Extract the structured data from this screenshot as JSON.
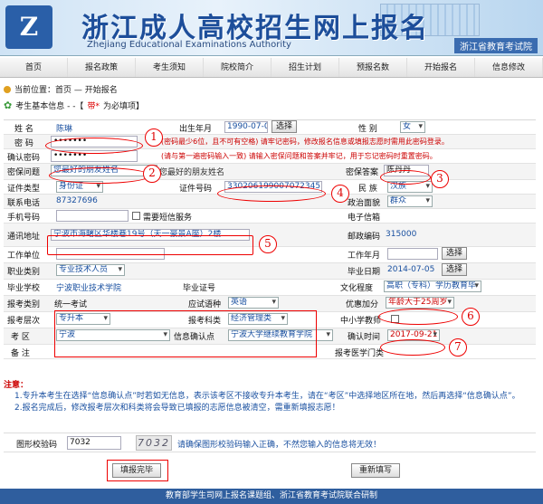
{
  "banner": {
    "logo": "Z",
    "title": "浙江成人高校招生网上报名",
    "subtitle": "Zhejiang Educational Examinations Authority",
    "org": "浙江省教育考试院"
  },
  "nav": [
    "首页",
    "报名政策",
    "考生须知",
    "院校简介",
    "招生计划",
    "预报名数",
    "开始报名",
    "信息修改"
  ],
  "location": {
    "label": "当前位置：首页 — 开始报名"
  },
  "section": {
    "prefix": "考生基本信息 - -【",
    "star": "带*",
    "suffix": "为必填项】"
  },
  "form": {
    "name": {
      "label": "姓  名",
      "value": "陈琳"
    },
    "birth": {
      "label": "出生年月",
      "value": "1990-07-06",
      "btn": "选择"
    },
    "gender": {
      "label": "性  别",
      "value": "女"
    },
    "password": {
      "label": "密  码",
      "value": "•••••••",
      "hint": "(密码最少6位，且不可有空格) 请牢记密码，修改报名信息或填报志愿时需用此密码登录。"
    },
    "confirm": {
      "label": "确认密码",
      "value": "•••••••",
      "hint": "(请与第一遍密码输入一致)  请输入密保问题和答案并牢记，用于忘记密码时重置密码。"
    },
    "question": {
      "label": "密保问题",
      "value": "您最好的朋友姓名",
      "text": "您最好的朋友姓名"
    },
    "answer": {
      "label": "密保答案",
      "value": "陈丹丹"
    },
    "idtype": {
      "label": "证件类型",
      "value": "身份证"
    },
    "idno": {
      "label": "证件号码",
      "value": "330206199007072345"
    },
    "nation": {
      "label": "民  族",
      "value": "汉族"
    },
    "phone": {
      "label": "联系电话",
      "value": "87327696"
    },
    "politics": {
      "label": "政治面貌",
      "value": "群众"
    },
    "mobile": {
      "label": "手机号码",
      "sms": "需要短信服务"
    },
    "email": {
      "label": "电子信箱"
    },
    "address": {
      "label": "通讯地址",
      "value": "宁波市海曙区华楼巷19号（天一豪景A座）2楼"
    },
    "postcode": {
      "label": "邮政编码",
      "value": "315000"
    },
    "workunit": {
      "label": "工作单位"
    },
    "workyear": {
      "label": "工作年月",
      "btn": "选择"
    },
    "job": {
      "label": "职业类别",
      "value": "专业技术人员"
    },
    "graddate": {
      "label": "毕业日期",
      "value": "2014-07-05",
      "btn": "选择"
    },
    "school": {
      "label": "毕业学校",
      "value": "宁波职业技术学院"
    },
    "certno": {
      "label": "毕业证号"
    },
    "edu": {
      "label": "文化程度",
      "value": "高职（专科）学历教育毕"
    },
    "examtype": {
      "label": "报考类别",
      "value": "统一考试"
    },
    "lang": {
      "label": "应试语种",
      "value": "英语"
    },
    "bonus": {
      "label": "优惠加分",
      "value": "年龄大于25周岁"
    },
    "level": {
      "label": "报考层次",
      "value": "专升本"
    },
    "subject": {
      "label": "报考科类",
      "value": "经济管理类"
    },
    "teacher": {
      "label": "中小学教师"
    },
    "area": {
      "label": "考  区",
      "value": "宁波"
    },
    "confirmpt": {
      "label": "信息确认点",
      "value": "宁波大学继续教育学院"
    },
    "confirmtime": {
      "label": "确认时间",
      "value": "2017-09-21"
    },
    "remark": {
      "label": "备  注"
    },
    "medical": {
      "label": "报考医学门类"
    }
  },
  "notes": {
    "title": "注意：",
    "items": [
      "1.专升本考生在选择“信息确认点”时若如无信息，表示该考区不接收专升本考生，请在“考区”中选择地区所在地，然后再选择“信息确认点”。",
      "2.报名完成后，修改报考层次和科类将会导致已填报的志愿信息被清空，需重新填报志愿！"
    ]
  },
  "captcha": {
    "label": "图形校验码",
    "value": "7032",
    "image": "7032",
    "hint": "请确保图形校验码输入正确，不然您输入的信息将无效！"
  },
  "buttons": {
    "submit": "填报完毕",
    "reset": "重新填写"
  },
  "footer": "教育部学生司网上报名课题组、浙江省教育考试院联合研制",
  "markers": [
    "1",
    "2",
    "3",
    "4",
    "5",
    "6",
    "7"
  ]
}
